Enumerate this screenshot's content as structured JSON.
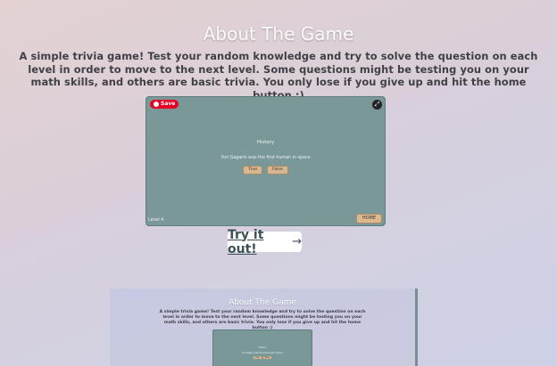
{
  "page": {
    "title": "About The Game",
    "description": "A simple trivia game! Test your random knowledge and try to solve the question on each level in order to move to the next level. Some questions might be testing you on your math skills, and others are basic trivia. You only lose if you give up and hit the home button :)"
  },
  "screenshot": {
    "save_label": "Save",
    "expand_icon": "expand-icon",
    "category": "History",
    "question": "Yuri Gagarin was the first human in space",
    "answers": [
      "True",
      "False"
    ],
    "level": "Level 4",
    "home_label": "HOME"
  },
  "cta": {
    "label": "Try it out!",
    "arrow": "→"
  },
  "preview": {
    "title": "About The Game",
    "description": "A simple trivia game! Test your random knowledge and try to solve the question on each level in order to move to the next level. Some questions might be testing you on your math skills, and others are basic trivia. You only lose if you give up and hit the home button :)",
    "category": "History",
    "question": "Yuri Gagarin was the first human in space",
    "answers": [
      "True",
      "False"
    ]
  },
  "colors": {
    "accent": "#e60023",
    "card": "#7a9898",
    "button": "#d8b690",
    "link_text": "#3d5159"
  }
}
